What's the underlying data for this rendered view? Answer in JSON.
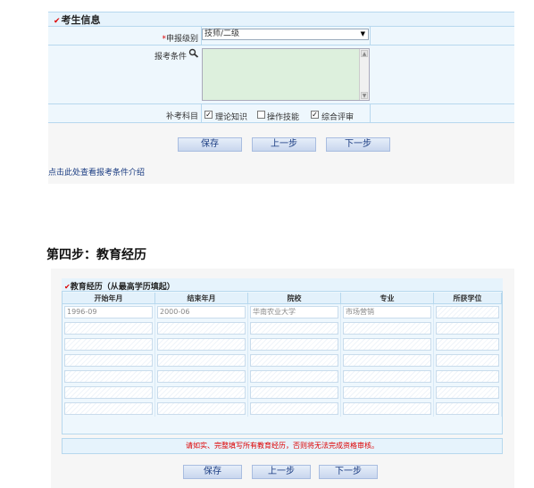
{
  "candidate_info": {
    "title": "考生信息",
    "apply_level": {
      "label": "申报级别",
      "required_mark": "*",
      "value": "技师/二级"
    },
    "apply_condition": {
      "label": "报考条件"
    },
    "supplementary_subjects": {
      "label": "补考科目",
      "options": [
        {
          "label": "理论知识",
          "checked": true
        },
        {
          "label": "操作技能",
          "checked": false
        },
        {
          "label": "综合评审",
          "checked": true
        }
      ]
    },
    "buttons": {
      "save": "保存",
      "prev": "上一步",
      "next": "下一步"
    },
    "view_conditions_link": "点击此处查看报考条件介绍"
  },
  "step_heading": "第四步：教育经历",
  "education": {
    "title": "教育经历（从最高学历填起）",
    "columns": [
      "开始年月",
      "结束年月",
      "院校",
      "专业",
      "所获学位"
    ],
    "rows": [
      [
        "1996-09",
        "2000-06",
        "华南农业大学",
        "市场营销",
        ""
      ],
      [
        "",
        "",
        "",
        "",
        ""
      ],
      [
        "",
        "",
        "",
        "",
        ""
      ],
      [
        "",
        "",
        "",
        "",
        ""
      ],
      [
        "",
        "",
        "",
        "",
        ""
      ],
      [
        "",
        "",
        "",
        "",
        ""
      ],
      [
        "",
        "",
        "",
        "",
        ""
      ]
    ],
    "notice": "请如实、完整填写所有教育经历，否则将无法完成资格审核。",
    "buttons": {
      "save": "保存",
      "prev": "上一步",
      "next": "下一步"
    }
  }
}
